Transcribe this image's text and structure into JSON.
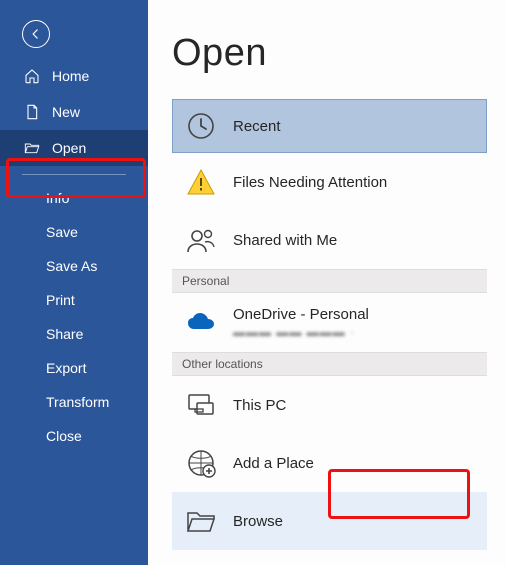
{
  "pageTitle": "Open",
  "sidebar": {
    "top": [
      {
        "label": "Home",
        "icon": "home"
      },
      {
        "label": "New",
        "icon": "new"
      },
      {
        "label": "Open",
        "icon": "open",
        "selected": true
      }
    ],
    "sub": [
      {
        "label": "Info"
      },
      {
        "label": "Save"
      },
      {
        "label": "Save As"
      },
      {
        "label": "Print"
      },
      {
        "label": "Share"
      },
      {
        "label": "Export"
      },
      {
        "label": "Transform"
      },
      {
        "label": "Close"
      }
    ]
  },
  "locations": {
    "recent": "Recent",
    "filesNeeding": "Files Needing Attention",
    "shared": "Shared with Me",
    "headerPersonal": "Personal",
    "oneDrive": "OneDrive - Personal",
    "oneDriveSub": "▬▬▬ ▬▬ ▬▬▬ ·",
    "headerOther": "Other locations",
    "thisPC": "This PC",
    "addPlace": "Add a Place",
    "browse": "Browse"
  }
}
